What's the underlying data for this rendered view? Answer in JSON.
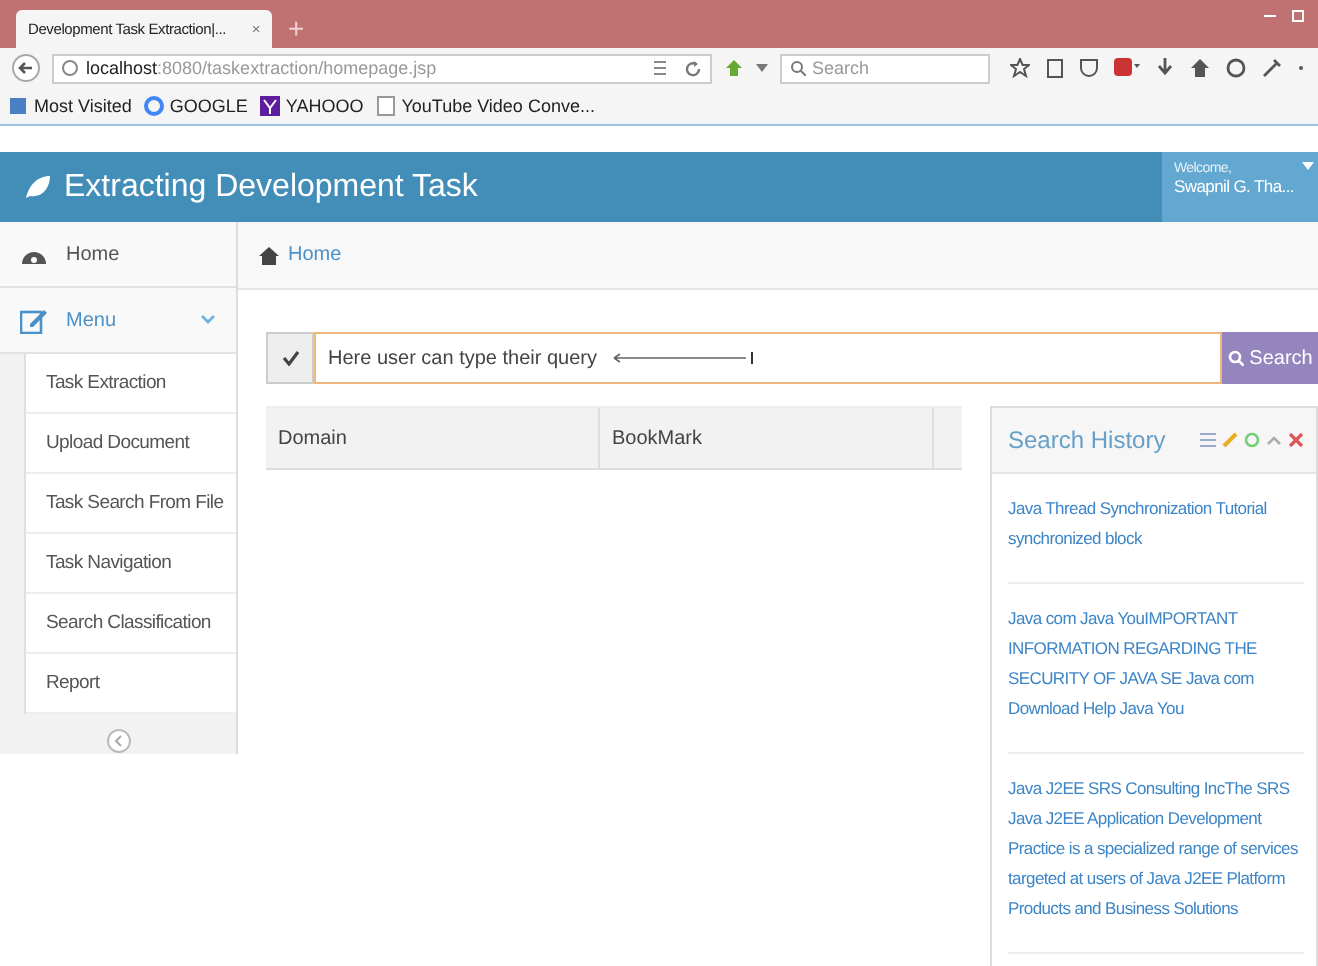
{
  "browser": {
    "tab": {
      "title": "Development Task Extraction|...",
      "close": "×"
    },
    "new_tab": "+",
    "address": {
      "host": "localhost",
      "path": ":8080/taskextraction/homepage.jsp"
    },
    "search": {
      "placeholder": "Search"
    },
    "bookmarks": [
      {
        "label": "Most Visited",
        "kind": "folder"
      },
      {
        "label": "GOOGLE",
        "kind": "g"
      },
      {
        "label": "YAHOOO",
        "kind": "y"
      },
      {
        "label": "YouTube Video Conve...",
        "kind": "page"
      }
    ]
  },
  "app": {
    "title": "Extracting Development Task",
    "welcome": "Welcome,",
    "user": "Swapnil G. Tha..."
  },
  "sidebar": {
    "items": [
      {
        "label": "Home",
        "kind": "link"
      },
      {
        "label": "Menu",
        "kind": "group",
        "expanded": true,
        "children": [
          {
            "label": "Task Extraction"
          },
          {
            "label": "Upload Document"
          },
          {
            "label": "Task Search From File"
          },
          {
            "label": "Task Navigation"
          },
          {
            "label": "Search Classification"
          },
          {
            "label": "Report"
          }
        ]
      }
    ]
  },
  "breadcrumb": "Home",
  "query": {
    "value": "Here user can type their query",
    "button": "Search"
  },
  "table": {
    "columns": [
      "Domain",
      "BookMark"
    ]
  },
  "search_history": {
    "title": "Search History",
    "entries": [
      "Java Thread Synchronization Tutorial synchronized block",
      "Java com Java YouIMPORTANT INFORMATION REGARDING THE SECURITY OF JAVA SE Java com Download Help Java You",
      "Java J2EE SRS Consulting IncThe SRS Java J2EE Application Development Practice is a specialized range of services targeted at users of Java J2EE Platform Products and Business Solutions"
    ]
  }
}
